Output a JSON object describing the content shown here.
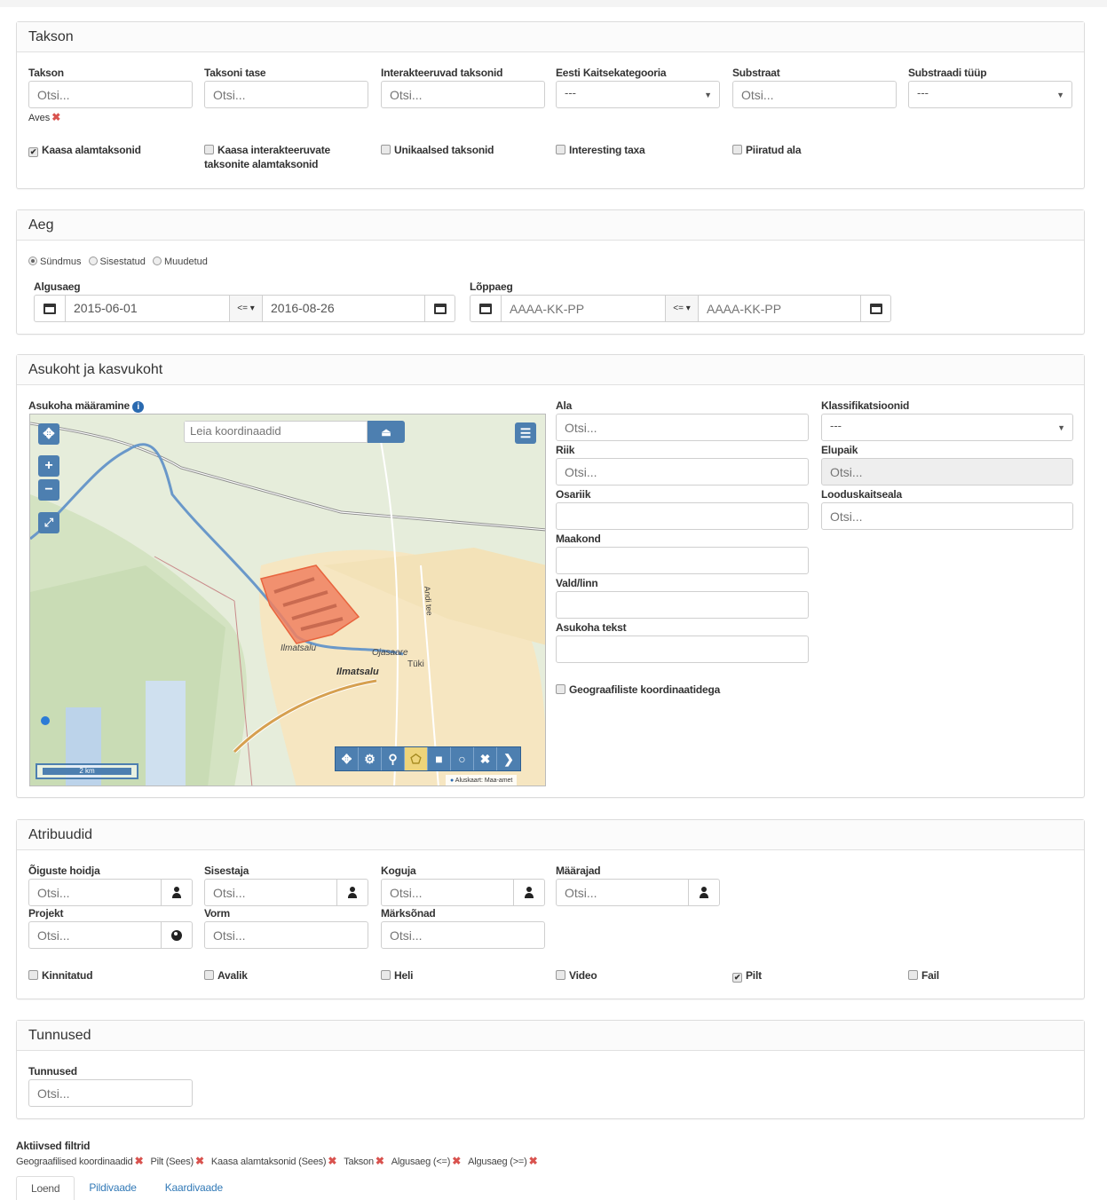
{
  "taxon_panel": {
    "title": "Takson",
    "fields": [
      {
        "label": "Takson",
        "placeholder": "Otsi..."
      },
      {
        "label": "Taksoni tase",
        "placeholder": "Otsi..."
      },
      {
        "label": "Interakteeruvad taksonid",
        "placeholder": "Otsi..."
      },
      {
        "label": "Eesti Kaitsekategooria",
        "value": "---"
      },
      {
        "label": "Substraat",
        "placeholder": "Otsi..."
      },
      {
        "label": "Substraadi tüüp",
        "value": "---"
      }
    ],
    "selected_taxon": "Aves",
    "checkboxes": [
      {
        "label": "Kaasa alamtaksonid",
        "checked": true
      },
      {
        "label": "Kaasa interakteeruvate taksonite alamtaksonid",
        "checked": false
      },
      {
        "label": "Unikaalsed taksonid",
        "checked": false
      },
      {
        "label": "Interesting taxa",
        "checked": false
      },
      {
        "label": "Piiratud ala",
        "checked": false
      }
    ]
  },
  "time_panel": {
    "title": "Aeg",
    "radios": [
      {
        "label": "Sündmus",
        "selected": true
      },
      {
        "label": "Sisestatud",
        "selected": false
      },
      {
        "label": "Muudetud",
        "selected": false
      }
    ],
    "start": {
      "label": "Algusaeg",
      "from": "2015-06-01",
      "op": "<= ▾",
      "to": "2016-08-26"
    },
    "end": {
      "label": "Lõppaeg",
      "from_placeholder": "AAAA-KK-PP",
      "op": "<= ▾",
      "to_placeholder": "AAAA-KK-PP"
    }
  },
  "location_panel": {
    "title": "Asukoht ja kasvukoht",
    "map_label": "Asukoha määramine",
    "coord_search_placeholder": "Leia koordinaadid",
    "map_labels": {
      "place1": "Ilmatsalu",
      "place2": "Ilmatsalu",
      "place3": "Ojasaare",
      "place4": "Tüki",
      "road": "Andi tee",
      "scale": "2 km",
      "attribution": "Aluskaart: Maa-amet"
    },
    "fields_mid": [
      {
        "label": "Ala",
        "placeholder": "Otsi..."
      },
      {
        "label": "Riik",
        "placeholder": "Otsi..."
      },
      {
        "label": "Osariik",
        "placeholder": ""
      },
      {
        "label": "Maakond",
        "placeholder": ""
      },
      {
        "label": "Vald/linn",
        "placeholder": ""
      },
      {
        "label": "Asukoha tekst",
        "placeholder": ""
      }
    ],
    "fields_right": [
      {
        "label": "Klassifikatsioonid",
        "value": "---"
      },
      {
        "label": "Elupaik",
        "placeholder": "Otsi..."
      },
      {
        "label": "Looduskaitseala",
        "placeholder": "Otsi..."
      }
    ],
    "geo_checkbox": "Geograafiliste koordinaatidega"
  },
  "attributes_panel": {
    "title": "Atribuudid",
    "row1": [
      {
        "label": "Õiguste hoidja",
        "placeholder": "Otsi..."
      },
      {
        "label": "Sisestaja",
        "placeholder": "Otsi..."
      },
      {
        "label": "Koguja",
        "placeholder": "Otsi..."
      },
      {
        "label": "Määrajad",
        "placeholder": "Otsi..."
      }
    ],
    "row2": [
      {
        "label": "Projekt",
        "placeholder": "Otsi..."
      },
      {
        "label": "Vorm",
        "placeholder": "Otsi..."
      },
      {
        "label": "Märksõnad",
        "placeholder": "Otsi..."
      }
    ],
    "checkboxes": [
      {
        "label": "Kinnitatud",
        "checked": false
      },
      {
        "label": "Avalik",
        "checked": false
      },
      {
        "label": "Heli",
        "checked": false
      },
      {
        "label": "Video",
        "checked": false
      },
      {
        "label": "Pilt",
        "checked": true
      },
      {
        "label": "Fail",
        "checked": false
      }
    ]
  },
  "tags_panel": {
    "title": "Tunnused",
    "field": {
      "label": "Tunnused",
      "placeholder": "Otsi..."
    }
  },
  "active_filters": {
    "label": "Aktiivsed filtrid",
    "items": [
      "Geograafilised koordinaadid",
      "Pilt (Sees)",
      "Kaasa alamtaksonid (Sees)",
      "Takson",
      "Algusaeg (<=)",
      "Algusaeg (>=)"
    ]
  },
  "tabs": [
    "Loend",
    "Pildivaade",
    "Kaardivaade"
  ],
  "colors": {
    "accent": "#337ab7",
    "map_button": "#4d7fb0",
    "polygon": "#f08060",
    "remove": "#d9534f"
  }
}
